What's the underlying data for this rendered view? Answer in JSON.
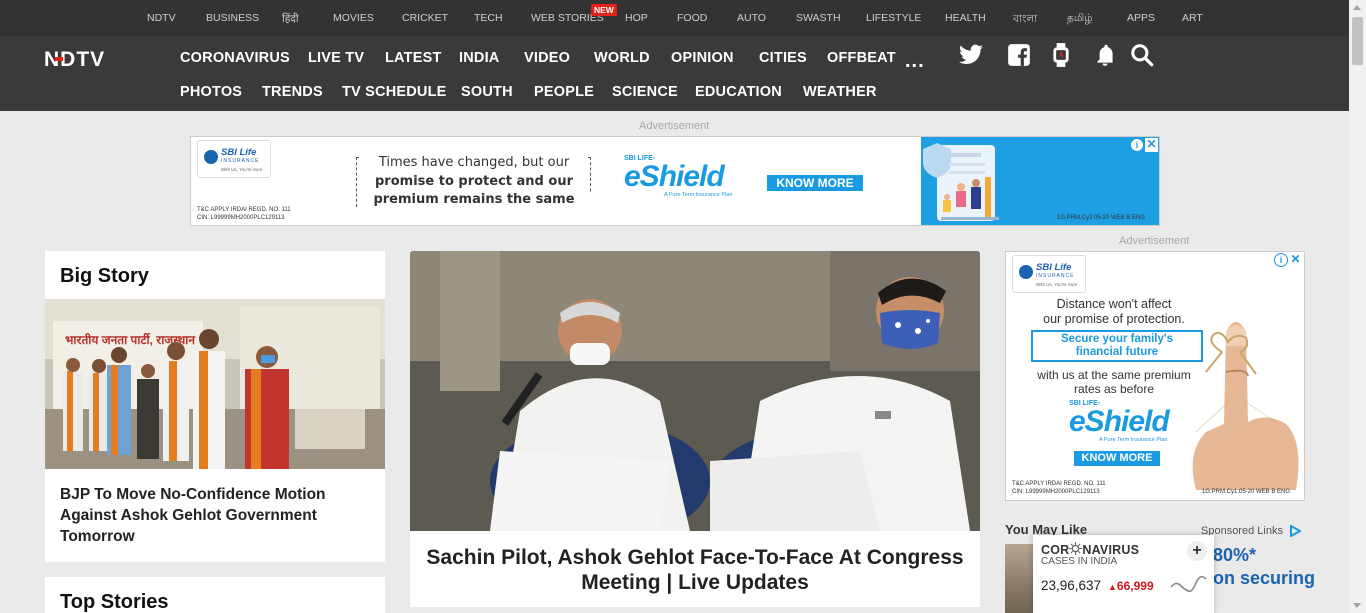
{
  "topstrip": {
    "links": [
      "NDTV",
      "BUSINESS",
      "हिंदी",
      "MOVIES",
      "CRICKET",
      "TECH",
      "WEB STORIES",
      "HOP",
      "FOOD",
      "AUTO",
      "SWASTH",
      "LIFESTYLE",
      "HEALTH",
      "বাংলা",
      "தமிழ்",
      "APPS",
      "ART"
    ],
    "new_badge": "NEW"
  },
  "header": {
    "logo": "NDTV",
    "nav_row1": [
      "CORONAVIRUS",
      "LIVE TV",
      "LATEST",
      "INDIA",
      "VIDEO",
      "WORLD",
      "OPINION",
      "CITIES",
      "OFFBEAT"
    ],
    "nav_row2": [
      "PHOTOS",
      "TRENDS",
      "TV SCHEDULE",
      "SOUTH",
      "PEOPLE",
      "SCIENCE",
      "EDUCATION",
      "WEATHER"
    ],
    "more": "...",
    "icons": [
      "twitter-icon",
      "facebook-icon",
      "smartwatch-icon",
      "notification-bell-icon",
      "search-icon"
    ]
  },
  "ads": {
    "label": "Advertisement",
    "top_banner": {
      "brand": "SBI Life",
      "brand_sub": "INSURANCE",
      "brand_tag": "With Us, You're Sure",
      "line1": "Times have changed, but our",
      "line2": "promise to protect and our",
      "line3": "premium remains the same",
      "product_small": "SBI LIFE-",
      "product": "eShield",
      "product_sub": "A Pure Term Insurance Plan",
      "cta": "KNOW MORE",
      "fine_left1": "T&C APPLY  IRDAI REGD. NO. 111",
      "fine_left2": "CIN: L99999MH2000PLC129113",
      "fine_right": "1G.PRM.Cy2.05-20 WEB B ENG"
    },
    "side_banner": {
      "brand": "SBI Life",
      "brand_sub": "INSURANCE",
      "brand_tag": "With Us, You're Sure",
      "line1": "Distance won't affect",
      "line2": "our promise of protection.",
      "highlight1": "Secure your family's",
      "highlight2": "financial future",
      "line3": "with us at the same premium",
      "line4": "rates as before",
      "product_small": "SBI LIFE-",
      "product": "eShield",
      "product_sub": "A Pure Term Insurance Plan",
      "cta": "KNOW MORE",
      "fine_left1": "T&C APPLY  IRDAI REGD. NO. 111",
      "fine_left2": "CIN: L99999MH2000PLC129113",
      "fine_right": "1G.PRM.Cy1.05-20 WEB B ENG"
    }
  },
  "big_story": {
    "heading": "Big Story",
    "title": "BJP To Move No-Confidence Motion Against Ashok Gehlot Government Tomorrow",
    "banner_text": "भारतीय जनता पार्टी, राजस्थान"
  },
  "hero": {
    "title": "Sachin Pilot, Ashok Gehlot Face-To-Face At Congress Meeting | Live Updates"
  },
  "top_stories": {
    "heading": "Top Stories"
  },
  "you_may_like": {
    "heading": "You May Like",
    "sponsored": "Sponsored Links",
    "teaser_line1": "80%*",
    "teaser_line2": "on securing"
  },
  "corona": {
    "title_pre": "COR",
    "title_post": "NAVIRUS",
    "subtitle": "CASES IN INDIA",
    "cases": "23,96,637",
    "delta": "66,999",
    "expand": "+"
  },
  "colors": {
    "header_bg": "#3a3a3a",
    "topstrip_bg": "#333333",
    "accent_red": "#e2231a",
    "ad_blue": "#1a9ae0"
  }
}
